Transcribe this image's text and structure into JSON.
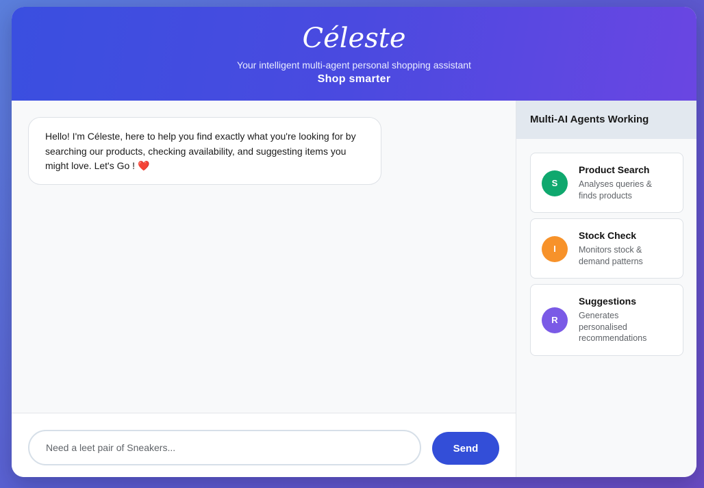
{
  "header": {
    "title": "Céleste",
    "subtitle": "Your intelligent multi-agent personal shopping assistant",
    "tagline": "Shop smarter"
  },
  "chat": {
    "messages": [
      {
        "text": "Hello! I'm Céleste, here to help you find exactly what you're looking for by searching our products, checking availability, and suggesting items you might love. Let's Go ! ",
        "emoji": "❤️"
      }
    ]
  },
  "composer": {
    "placeholder": "Need a leet pair of Sneakers...",
    "value": "",
    "send_label": "Send"
  },
  "sidebar": {
    "title": "Multi-AI Agents Working",
    "agents": [
      {
        "initial": "S",
        "name": "Product Search",
        "description": "Analyses queries & finds products",
        "color": "#0fa86e"
      },
      {
        "initial": "I",
        "name": "Stock Check",
        "description": "Monitors stock & demand patterns",
        "color": "#f7922a"
      },
      {
        "initial": "R",
        "name": "Suggestions",
        "description": "Generates personalised recommendations",
        "color": "#7a5ae6"
      }
    ]
  },
  "colors": {
    "accent": "#334ed8",
    "header_gradient_start": "#3a4fe0",
    "header_gradient_end": "#6a46e2"
  }
}
